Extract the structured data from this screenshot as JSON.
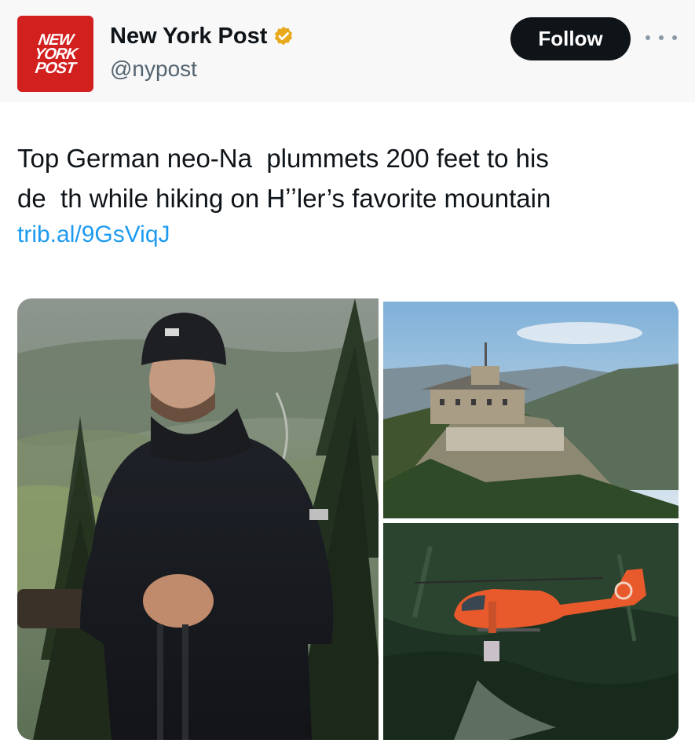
{
  "account": {
    "avatar_text": [
      "NEW",
      "YORK",
      "POST"
    ],
    "display_name": "New York Post",
    "handle": "@nypost",
    "verified": true,
    "avatar_color": "#d2201f",
    "badge_color": "#e8a91c"
  },
  "actions": {
    "follow_label": "Follow",
    "more_icon": "more-horizontal-icon"
  },
  "tweet": {
    "text_line1": "Top German neo-Na  plummets 200 feet to his",
    "text_line2": "de  th while hiking on Hʼʼler’s favorite mountain",
    "link": "trib.al/9GsViqJ",
    "link_color": "#1d9bf0"
  },
  "media": {
    "images": [
      {
        "name": "hiker-photo"
      },
      {
        "name": "mountain-house-photo"
      },
      {
        "name": "rescue-helicopter-photo"
      }
    ]
  }
}
